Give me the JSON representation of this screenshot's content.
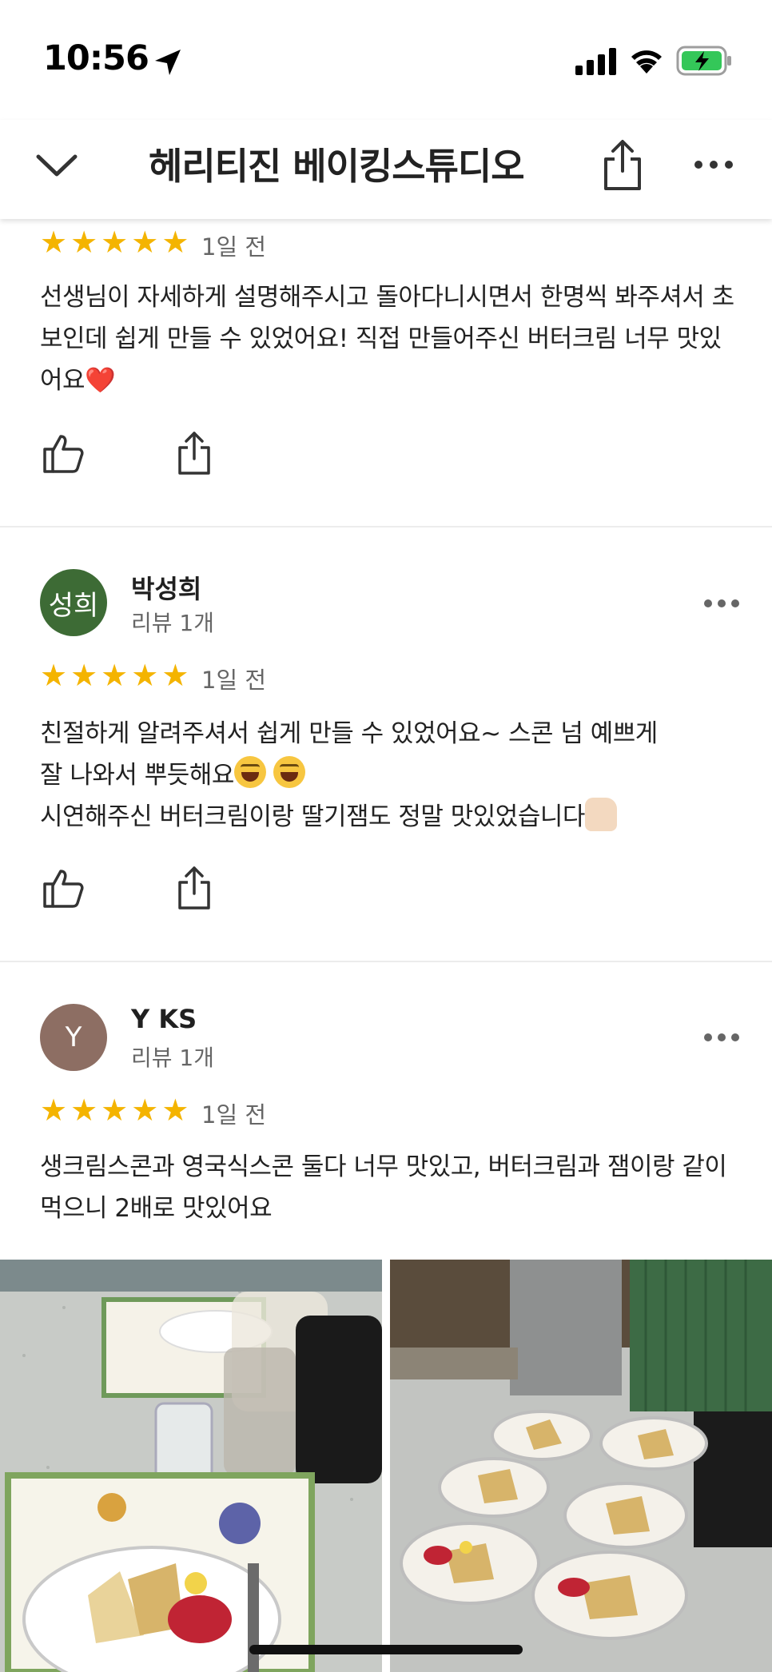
{
  "status_bar": {
    "time": "10:56",
    "icons": [
      "location-arrow-icon",
      "cellular-signal-icon",
      "wifi-icon",
      "battery-charging-icon"
    ],
    "battery_color": "#34c759"
  },
  "header": {
    "title": "헤리티진 베이킹스튜디오",
    "icons": [
      "chevron-down-icon",
      "share-icon",
      "more-icon"
    ]
  },
  "reviews": [
    {
      "stars": 5,
      "date": "1일 전",
      "text": "선생님이 자세하게 설명해주시고 돌아다니시면서 한명씩 봐주셔서 초보인데 쉽게 만들 수 있었어요! 직접 만들어주신 버터크림 너무 맛있어요",
      "emoji": "❤️"
    },
    {
      "author": "박성희",
      "avatar_text": "성희",
      "avatar_color": "#3d6b35",
      "count": "리뷰 1개",
      "stars": 5,
      "date": "1일 전",
      "text_lines": [
        "친절하게 알려주셔서 쉽게 만들 수 있었어요~ 스콘 넘 예쁘게",
        "잘 나와서 뿌듯해요",
        "시연해주신 버터크림이랑 딸기잼도 정말 맛있었습니다"
      ],
      "emoji_face": "😆",
      "emoji_thumb": "👍🏻"
    },
    {
      "author": "Y KS",
      "avatar_text": "Y",
      "avatar_color": "#8d6e63",
      "count": "리뷰 1개",
      "stars": 5,
      "date": "1일 전",
      "text": "생크림스콘과 영국식스콘 둘다 너무 맛있고, 버터크림과 잼이랑 같이 먹으니 2배로 맛있어요",
      "photos": 2
    }
  ],
  "colors": {
    "star": "#f4b400",
    "divider": "#ececec"
  }
}
